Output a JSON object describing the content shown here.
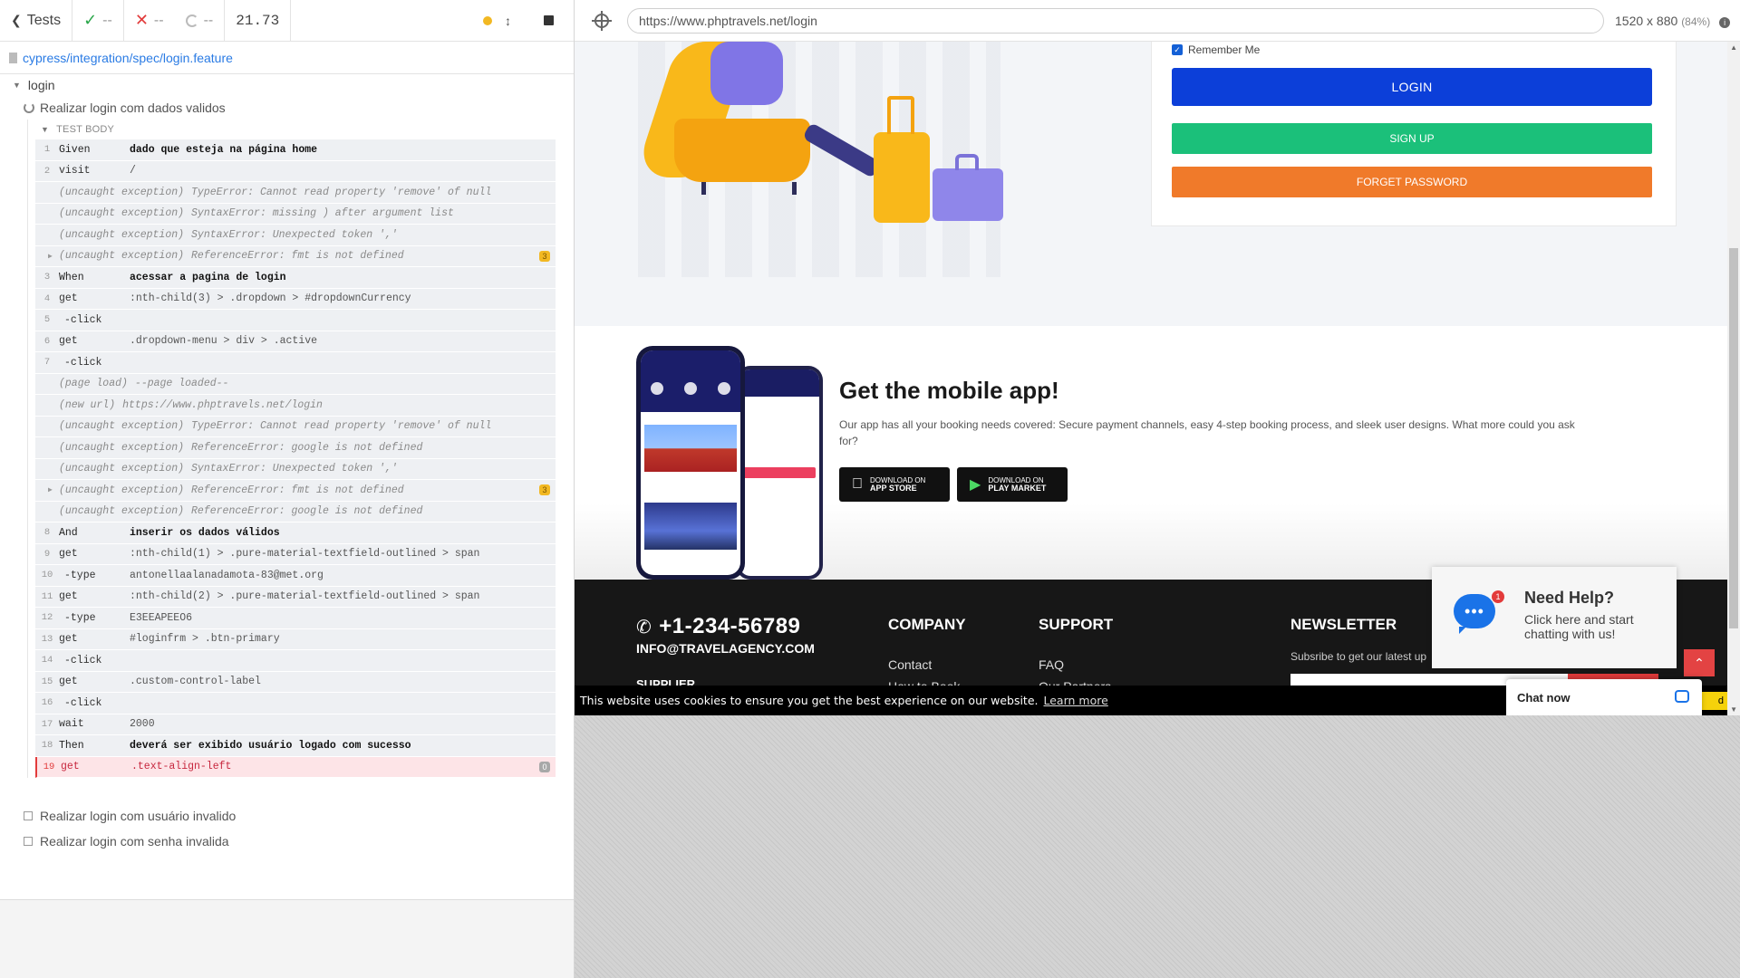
{
  "reporter": {
    "tests_link": "Tests",
    "passed": "--",
    "failed": "--",
    "pending": "--",
    "duration": "21.73",
    "spec_path": "cypress/integration/spec/login.feature",
    "suite": "login",
    "current_test": "Realizar login com dados validos",
    "test_body_label": "TEST BODY",
    "commands": [
      {
        "num": "1",
        "name": "Given",
        "msg": "dado que esteja na página home",
        "kind": "step"
      },
      {
        "num": "2",
        "name": "visit",
        "msg": "/",
        "kind": "cmd"
      },
      {
        "num": "",
        "name": "(uncaught exception)",
        "msg": "TypeError: Cannot read property 'remove' of null",
        "kind": "exc"
      },
      {
        "num": "",
        "name": "(uncaught exception)",
        "msg": "SyntaxError: missing ) after argument list",
        "kind": "exc"
      },
      {
        "num": "",
        "name": "(uncaught exception)",
        "msg": "SyntaxError: Unexpected token ','",
        "kind": "exc"
      },
      {
        "num": "",
        "name": "(uncaught exception)",
        "msg": "ReferenceError: fmt is not defined",
        "kind": "exc",
        "badge": "3",
        "expand": true
      },
      {
        "num": "3",
        "name": "When",
        "msg": "acessar a pagina de login",
        "kind": "step"
      },
      {
        "num": "4",
        "name": "get",
        "msg": ":nth-child(3) > .dropdown > #dropdownCurrency",
        "kind": "cmd"
      },
      {
        "num": "5",
        "name": "-click",
        "msg": "",
        "kind": "sub"
      },
      {
        "num": "6",
        "name": "get",
        "msg": ".dropdown-menu > div > .active",
        "kind": "cmd"
      },
      {
        "num": "7",
        "name": "-click",
        "msg": "",
        "kind": "sub"
      },
      {
        "num": "",
        "name": "(page load)",
        "msg": "--page loaded--",
        "kind": "exc"
      },
      {
        "num": "",
        "name": "(new url)",
        "msg": "https://www.phptravels.net/login",
        "kind": "exc"
      },
      {
        "num": "",
        "name": "(uncaught exception)",
        "msg": "TypeError: Cannot read property 'remove' of null",
        "kind": "exc"
      },
      {
        "num": "",
        "name": "(uncaught exception)",
        "msg": "ReferenceError: google is not defined",
        "kind": "exc"
      },
      {
        "num": "",
        "name": "(uncaught exception)",
        "msg": "SyntaxError: Unexpected token ','",
        "kind": "exc"
      },
      {
        "num": "",
        "name": "(uncaught exception)",
        "msg": "ReferenceError: fmt is not defined",
        "kind": "exc",
        "badge": "3",
        "expand": true
      },
      {
        "num": "",
        "name": "(uncaught exception)",
        "msg": "ReferenceError: google is not defined",
        "kind": "exc"
      },
      {
        "num": "8",
        "name": "And",
        "msg": "inserir os dados válidos",
        "kind": "step"
      },
      {
        "num": "9",
        "name": "get",
        "msg": ":nth-child(1) > .pure-material-textfield-outlined > span",
        "kind": "cmd"
      },
      {
        "num": "10",
        "name": "-type",
        "msg": "antonellaalanadamota-83@met.org",
        "kind": "sub"
      },
      {
        "num": "11",
        "name": "get",
        "msg": ":nth-child(2) > .pure-material-textfield-outlined > span",
        "kind": "cmd"
      },
      {
        "num": "12",
        "name": "-type",
        "msg": "E3EEAPEEO6",
        "kind": "sub"
      },
      {
        "num": "13",
        "name": "get",
        "msg": "#loginfrm > .btn-primary",
        "kind": "cmd"
      },
      {
        "num": "14",
        "name": "-click",
        "msg": "",
        "kind": "sub"
      },
      {
        "num": "15",
        "name": "get",
        "msg": ".custom-control-label",
        "kind": "cmd"
      },
      {
        "num": "16",
        "name": "-click",
        "msg": "",
        "kind": "sub"
      },
      {
        "num": "17",
        "name": "wait",
        "msg": "2000",
        "kind": "cmd"
      },
      {
        "num": "18",
        "name": "Then",
        "msg": "deverá ser exibido usuário logado com sucesso",
        "kind": "step"
      },
      {
        "num": "19",
        "name": "get",
        "msg": ".text-align-left",
        "kind": "err",
        "badge": "0"
      }
    ],
    "other_tests": [
      "Realizar login com usuário invalido",
      "Realizar login com senha invalida"
    ]
  },
  "aut": {
    "url": "https://www.phptravels.net/login",
    "viewport": "1520 x 880",
    "zoom": "(84%)",
    "login_card": {
      "remember_me": "Remember Me",
      "login_button": "LOGIN",
      "signup_button": "SIGN UP",
      "forget_button": "FORGET PASSWORD"
    },
    "mobile_app": {
      "title": "Get the mobile app!",
      "description": "Our app has all your booking needs covered: Secure payment channels, easy 4-step booking process, and sleek user designs. What more could you ask for?",
      "app_store_small": "DOWNLOAD ON",
      "app_store_big": "APP STORE",
      "play_small": "DOWNLOAD ON",
      "play_big": "PLAY MARKET"
    },
    "footer": {
      "phone": "+1-234-56789",
      "email": "INFO@TRAVELAGENCY.COM",
      "supplier": "SUPPLIER",
      "company_heading": "COMPANY",
      "company_links": [
        "Contact",
        "How to Book"
      ],
      "support_heading": "SUPPORT",
      "support_links": [
        "FAQ",
        "Our Partners"
      ],
      "newsletter_heading": "NEWSLETTER",
      "newsletter_sub": "Subsribe to get our latest up"
    },
    "help_widget": {
      "title": "Need Help?",
      "subtitle": "Click here and start chatting with us!",
      "badge": "1"
    },
    "cookie": {
      "text": "This website uses cookies to ensure you get the best experience on our website.",
      "learn_more": "Learn more",
      "accept_partial": "d"
    },
    "chat_now": "Chat now"
  },
  "colors": {
    "login_blue": "#0c3fd9",
    "signup_green": "#1bc07a",
    "forget_orange": "#f07a2a",
    "error_red": "#e23b3b",
    "pass_green": "#2aa64a",
    "warn_yellow": "#f2b822"
  }
}
